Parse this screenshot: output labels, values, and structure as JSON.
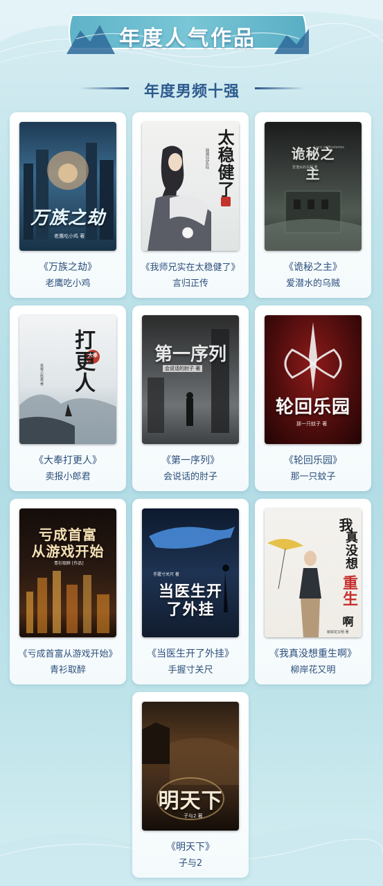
{
  "banner": {
    "title": "年度人气作品"
  },
  "section": {
    "title": "年度男频十强"
  },
  "books": [
    {
      "title": "《万族之劫》",
      "author": "老鹰吃小鸡",
      "cover_text": "万族之劫",
      "cover_author": "老鹰吃小鸡 著"
    },
    {
      "title": "《我师兄实在太稳健了》",
      "author": "言归正传",
      "cover_text": "太稳健了",
      "cover_sub": "我师兄实在"
    },
    {
      "title": "《诡秘之主》",
      "author": "爱潜水的乌贼",
      "cover_text": "诡秘之主",
      "cover_en": "Lord of Mysteries",
      "cover_author": "爱潜水的乌贼 著"
    },
    {
      "title": "《大奉打更人》",
      "author": "卖报小郎君",
      "cover_text": "打更人",
      "cover_seal": "大奉",
      "cover_author": "卖报小郎君 著"
    },
    {
      "title": "《第一序列》",
      "author": "会说话的肘子",
      "cover_text": "第一序列",
      "cover_author": "会说话的肘子 著"
    },
    {
      "title": "《轮回乐园》",
      "author": "那一只蚊子",
      "cover_text": "轮回乐园",
      "cover_author": "那一只蚊子 著"
    },
    {
      "title": "《亏成首富从游戏开始》",
      "author": "青衫取醉",
      "cover_text_1": "亏成首富",
      "cover_text_2": "从游戏开始",
      "cover_author": "青衫取醉 [作品]"
    },
    {
      "title": "《当医生开了外挂》",
      "author": "手握寸关尺",
      "cover_text_1": "当医生开",
      "cover_text_2": "了外挂",
      "cover_author": "手握寸关尺 著"
    },
    {
      "title": "《我真没想重生啊》",
      "author": "柳岸花又明",
      "cover_text_1": "我",
      "cover_text_2": "真没想",
      "cover_text_3": "重生",
      "cover_text_4": "啊",
      "cover_author": "柳岸花又明 著"
    },
    {
      "title": "《明天下》",
      "author": "子与2",
      "cover_text": "明天下",
      "cover_author": "子与2 著"
    }
  ],
  "colors": {
    "accent": "#2d5a8e",
    "card_text": "#2c4f7c",
    "background_top": "#d8eef3",
    "background_mid": "#b3dde6"
  }
}
